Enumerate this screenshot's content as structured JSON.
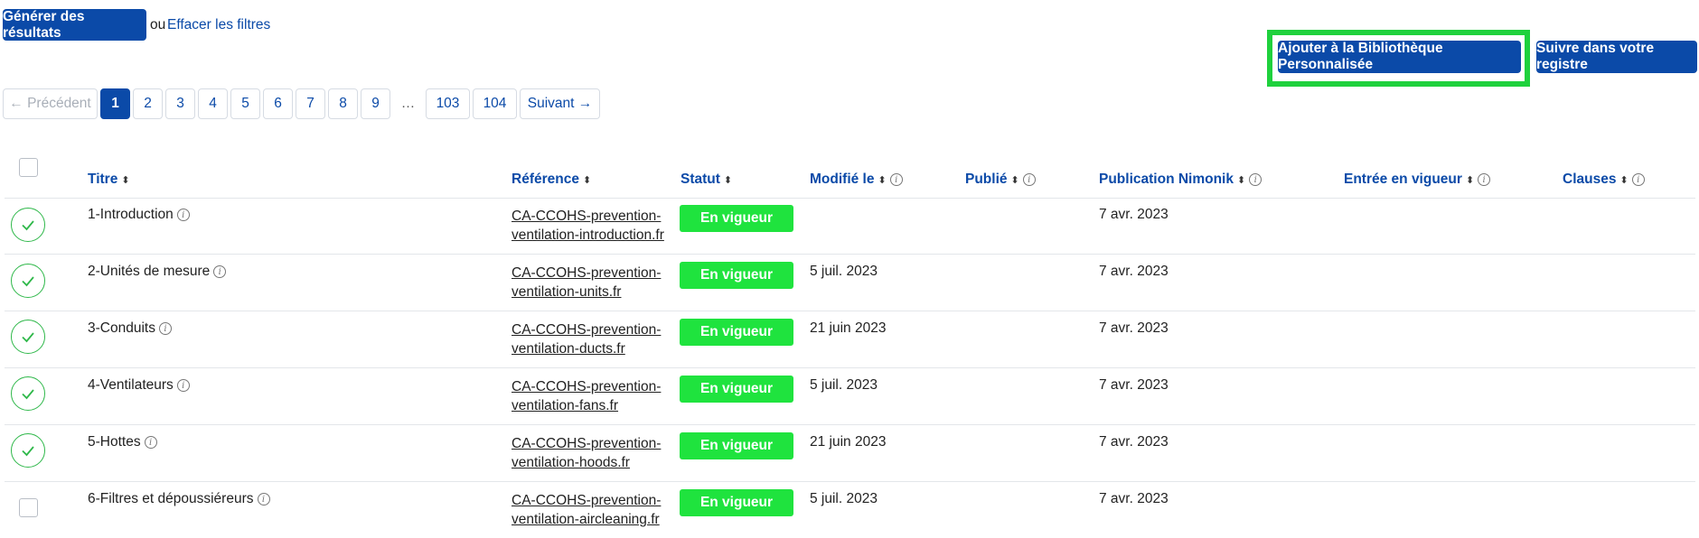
{
  "toolbar": {
    "generate_label": "Générer des résultats",
    "or_text": "ou",
    "clear_label": "Effacer les filtres",
    "add_library_label": "Ajouter à la Bibliothèque Personnalisée",
    "track_label": "Suivre dans votre registre"
  },
  "colors": {
    "primary": "#0b4aa8",
    "status_green": "#1fe33e",
    "highlight": "#1fd13d"
  },
  "pagination": {
    "prev": "← Précédent",
    "pages": [
      "1",
      "2",
      "3",
      "4",
      "5",
      "6",
      "7",
      "8",
      "9"
    ],
    "ellipsis": "…",
    "last_pages": [
      "103",
      "104"
    ],
    "active": "1",
    "next": "Suivant →"
  },
  "table": {
    "headers": {
      "title": "Titre",
      "reference": "Référence",
      "status": "Statut",
      "modified": "Modifié le",
      "published": "Publié",
      "nimonik": "Publication Nimonik",
      "effective": "Entrée en vigueur",
      "clauses": "Clauses"
    },
    "rows": [
      {
        "selected": true,
        "title": "1-Introduction",
        "ref1": "CA-CCOHS-prevention-",
        "ref2": "ventilation-introduction.fr",
        "status": "En vigueur",
        "modified": "",
        "nimonik": "7 avr. 2023"
      },
      {
        "selected": true,
        "title": "2-Unités de mesure",
        "ref1": "CA-CCOHS-prevention-",
        "ref2": "ventilation-units.fr",
        "status": "En vigueur",
        "modified": "5 juil. 2023",
        "nimonik": "7 avr. 2023"
      },
      {
        "selected": true,
        "title": "3-Conduits",
        "ref1": "CA-CCOHS-prevention-",
        "ref2": "ventilation-ducts.fr",
        "status": "En vigueur",
        "modified": "21 juin 2023",
        "nimonik": "7 avr. 2023"
      },
      {
        "selected": true,
        "title": "4-Ventilateurs",
        "ref1": "CA-CCOHS-prevention-",
        "ref2": "ventilation-fans.fr",
        "status": "En vigueur",
        "modified": "5 juil. 2023",
        "nimonik": "7 avr. 2023"
      },
      {
        "selected": true,
        "title": "5-Hottes",
        "ref1": "CA-CCOHS-prevention-",
        "ref2": "ventilation-hoods.fr",
        "status": "En vigueur",
        "modified": "21 juin 2023",
        "nimonik": "7 avr. 2023"
      },
      {
        "selected": false,
        "title": "6-Filtres et dépoussiéreurs",
        "ref1": "CA-CCOHS-prevention-",
        "ref2": "ventilation-aircleaning.fr",
        "status": "En vigueur",
        "modified": "5 juil. 2023",
        "nimonik": "7 avr. 2023"
      }
    ]
  }
}
